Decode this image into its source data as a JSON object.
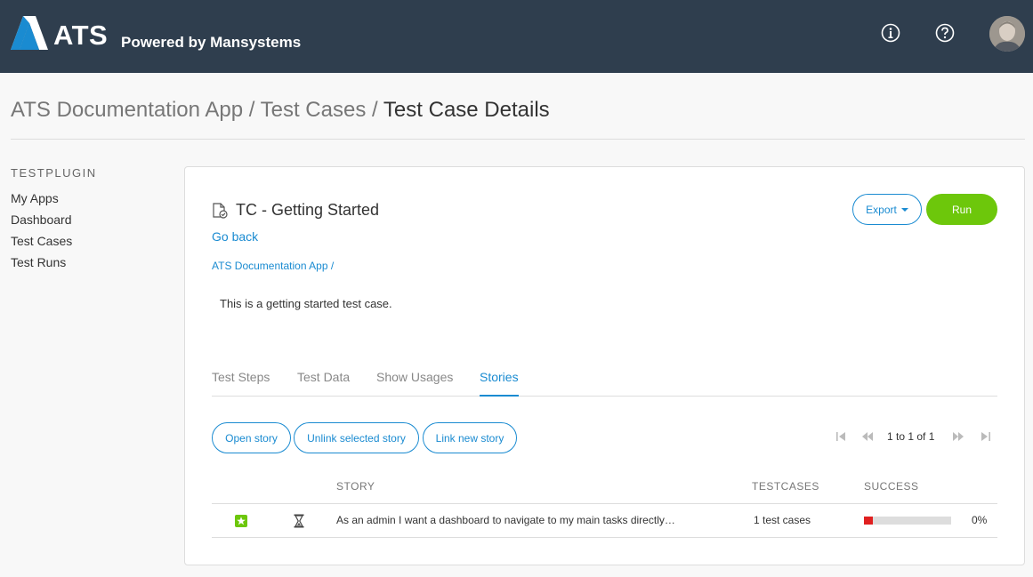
{
  "header": {
    "logo_text": "ATS",
    "logo_sub": "Powered by Mansystems",
    "brand_color": "#2f3e4e",
    "accent_color": "#1a8bd1",
    "icons": [
      "info-icon",
      "help-icon",
      "avatar"
    ]
  },
  "breadcrumb": {
    "items": [
      "ATS Documentation App",
      "Test Cases"
    ],
    "current": "Test Case Details",
    "separator": "/"
  },
  "sidebar": {
    "heading": "TESTPLUGIN",
    "items": [
      {
        "label": "My Apps"
      },
      {
        "label": "Dashboard"
      },
      {
        "label": "Test Cases"
      },
      {
        "label": "Test Runs"
      }
    ]
  },
  "testcase": {
    "title": "TC - Getting Started",
    "go_back": "Go back",
    "app_link": "ATS Documentation App /",
    "description": "This is a getting started test case.",
    "export_label": "Export",
    "run_label": "Run",
    "run_color": "#6dc70b"
  },
  "tabs": [
    {
      "label": "Test Steps",
      "active": false
    },
    {
      "label": "Test Data",
      "active": false
    },
    {
      "label": "Show Usages",
      "active": false
    },
    {
      "label": "Stories",
      "active": true
    }
  ],
  "actions": {
    "open_story": "Open story",
    "unlink_story": "Unlink selected story",
    "link_story": "Link new story"
  },
  "pager": {
    "text": "1 to 1 of 1"
  },
  "table": {
    "columns": [
      "STORY",
      "TESTCASES",
      "SUCCESS"
    ],
    "rows": [
      {
        "story": "As an admin I want a dashboard to navigate to my main tasks directly…",
        "testcases": "1 test cases",
        "success_label": "0%",
        "success_fraction": 0.1
      }
    ]
  }
}
